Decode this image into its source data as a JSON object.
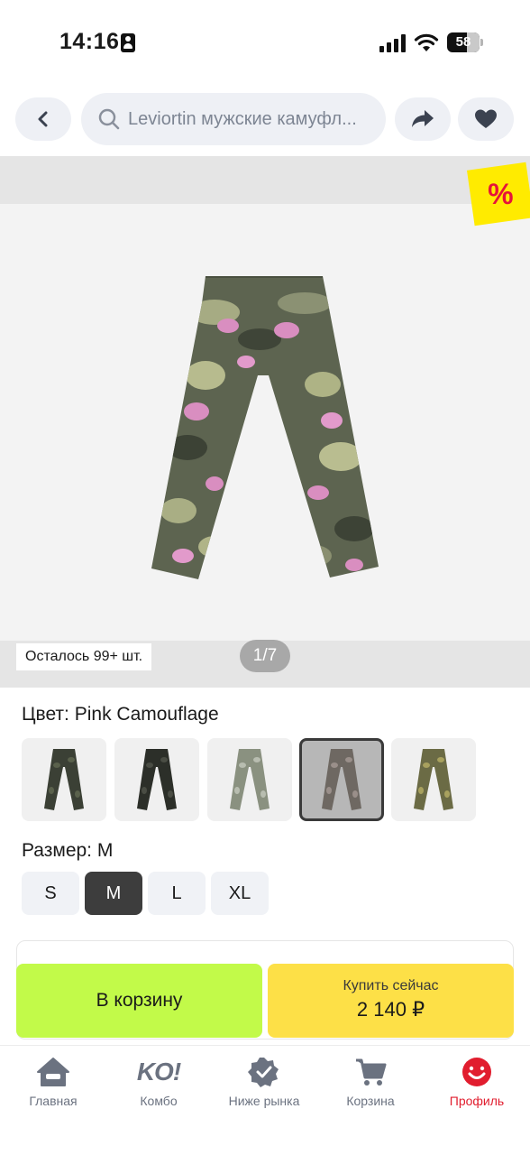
{
  "status_bar": {
    "time": "14:16",
    "battery": "58",
    "icons": [
      "person-icon",
      "signal-icon",
      "wifi-icon",
      "battery-icon"
    ]
  },
  "header": {
    "back_icon": "chevron-left-icon",
    "search_icon": "search-icon",
    "search_text": "Leviortin мужские камуфл...",
    "share_icon": "share-arrow-icon",
    "favorite_icon": "heart-icon"
  },
  "gallery": {
    "discount_badge": "%",
    "stock": "Осталось 99+ шт.",
    "page_counter": "1/7"
  },
  "color": {
    "title": "Цвет: Pink Camouflage",
    "options": [
      {
        "selected": false,
        "base": "#3b4035",
        "patch": "#5a614c"
      },
      {
        "selected": false,
        "base": "#2c2f29",
        "patch": "#4a4d44"
      },
      {
        "selected": false,
        "base": "#8a9180",
        "patch": "#b8bdb0"
      },
      {
        "selected": true,
        "base": "#6e6862",
        "patch": "#9a8f8a"
      },
      {
        "selected": false,
        "base": "#6b6b45",
        "patch": "#a8a15e"
      }
    ]
  },
  "size": {
    "title": "Размер: M",
    "options": [
      {
        "label": "S",
        "selected": false
      },
      {
        "label": "M",
        "selected": true
      },
      {
        "label": "L",
        "selected": false
      },
      {
        "label": "XL",
        "selected": false
      }
    ]
  },
  "actions": {
    "cart_label": "В корзину",
    "buy_label": "Купить сейчас",
    "buy_price": "2 140 ₽"
  },
  "nav": {
    "items": [
      {
        "label": "Главная",
        "icon": "home-icon",
        "active": false
      },
      {
        "label": "Комбо",
        "logo": "KO!",
        "active": false
      },
      {
        "label": "Ниже рынка",
        "icon": "verified-badge-icon",
        "active": false
      },
      {
        "label": "Корзина",
        "icon": "cart-icon",
        "active": false
      },
      {
        "label": "Профиль",
        "icon": "profile-smile-icon",
        "active": true
      }
    ]
  },
  "colors": {
    "accent_green": "#c2fa49",
    "accent_yellow": "#fde047",
    "active_red": "#e11d2e",
    "badge_yellow": "#ffeb00"
  }
}
